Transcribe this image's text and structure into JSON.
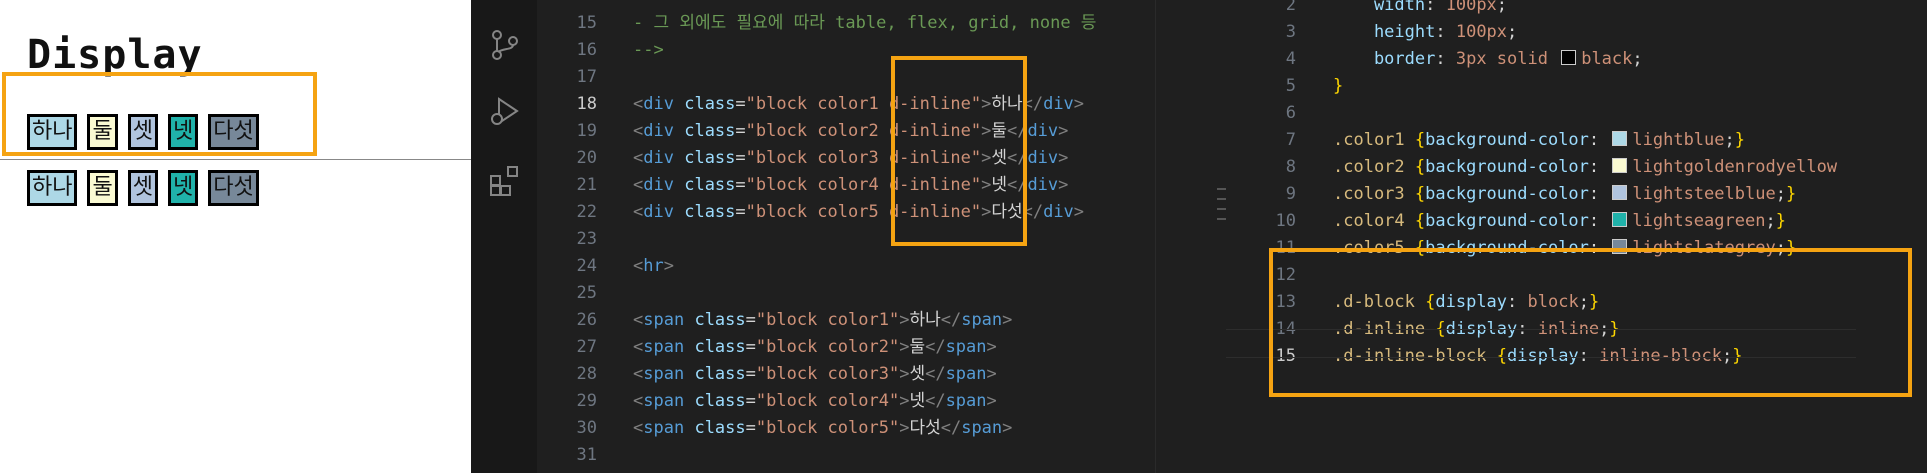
{
  "preview": {
    "heading": "Display",
    "row1": [
      "하나",
      "둘",
      "셋",
      "넷",
      "다섯"
    ],
    "row2": [
      "하나",
      "둘",
      "셋",
      "넷",
      "다섯"
    ]
  },
  "editor_left": {
    "lines": [
      {
        "n": "15",
        "parts": [
          {
            "c": "cmt",
            "t": "- 그 외에도 필요에 따라 table, flex, grid, none 등"
          }
        ]
      },
      {
        "n": "16",
        "parts": [
          {
            "c": "cmt",
            "t": "-->"
          }
        ]
      },
      {
        "n": "17",
        "parts": []
      },
      {
        "n": "18",
        "active": true,
        "parts": [
          {
            "c": "tag",
            "t": "<"
          },
          {
            "c": "tname",
            "t": "div"
          },
          {
            "c": "txt",
            "t": " "
          },
          {
            "c": "attr",
            "t": "class"
          },
          {
            "c": "txt",
            "t": "="
          },
          {
            "c": "str",
            "t": "\"block color1 d-inline\""
          },
          {
            "c": "tag",
            "t": ">"
          },
          {
            "c": "txt",
            "t": "하나"
          },
          {
            "c": "tag",
            "t": "</"
          },
          {
            "c": "tname",
            "t": "div"
          },
          {
            "c": "tag",
            "t": ">"
          }
        ]
      },
      {
        "n": "19",
        "parts": [
          {
            "c": "tag",
            "t": "<"
          },
          {
            "c": "tname",
            "t": "div"
          },
          {
            "c": "txt",
            "t": " "
          },
          {
            "c": "attr",
            "t": "class"
          },
          {
            "c": "txt",
            "t": "="
          },
          {
            "c": "str",
            "t": "\"block color2 d-inline\""
          },
          {
            "c": "tag",
            "t": ">"
          },
          {
            "c": "txt",
            "t": "둘"
          },
          {
            "c": "tag",
            "t": "</"
          },
          {
            "c": "tname",
            "t": "div"
          },
          {
            "c": "tag",
            "t": ">"
          }
        ]
      },
      {
        "n": "20",
        "parts": [
          {
            "c": "tag",
            "t": "<"
          },
          {
            "c": "tname",
            "t": "div"
          },
          {
            "c": "txt",
            "t": " "
          },
          {
            "c": "attr",
            "t": "class"
          },
          {
            "c": "txt",
            "t": "="
          },
          {
            "c": "str",
            "t": "\"block color3 d-inline\""
          },
          {
            "c": "tag",
            "t": ">"
          },
          {
            "c": "txt",
            "t": "셋"
          },
          {
            "c": "tag",
            "t": "</"
          },
          {
            "c": "tname",
            "t": "div"
          },
          {
            "c": "tag",
            "t": ">"
          }
        ]
      },
      {
        "n": "21",
        "parts": [
          {
            "c": "tag",
            "t": "<"
          },
          {
            "c": "tname",
            "t": "div"
          },
          {
            "c": "txt",
            "t": " "
          },
          {
            "c": "attr",
            "t": "class"
          },
          {
            "c": "txt",
            "t": "="
          },
          {
            "c": "str",
            "t": "\"block color4 d-inline\""
          },
          {
            "c": "tag",
            "t": ">"
          },
          {
            "c": "txt",
            "t": "넷"
          },
          {
            "c": "tag",
            "t": "</"
          },
          {
            "c": "tname",
            "t": "div"
          },
          {
            "c": "tag",
            "t": ">"
          }
        ]
      },
      {
        "n": "22",
        "parts": [
          {
            "c": "tag",
            "t": "<"
          },
          {
            "c": "tname",
            "t": "div"
          },
          {
            "c": "txt",
            "t": " "
          },
          {
            "c": "attr",
            "t": "class"
          },
          {
            "c": "txt",
            "t": "="
          },
          {
            "c": "str",
            "t": "\"block color5 d-inline\""
          },
          {
            "c": "tag",
            "t": ">"
          },
          {
            "c": "txt",
            "t": "다섯"
          },
          {
            "c": "tag",
            "t": "</"
          },
          {
            "c": "tname",
            "t": "div"
          },
          {
            "c": "tag",
            "t": ">"
          }
        ]
      },
      {
        "n": "23",
        "parts": []
      },
      {
        "n": "24",
        "parts": [
          {
            "c": "tag",
            "t": "<"
          },
          {
            "c": "tname",
            "t": "hr"
          },
          {
            "c": "tag",
            "t": ">"
          }
        ]
      },
      {
        "n": "25",
        "parts": []
      },
      {
        "n": "26",
        "parts": [
          {
            "c": "tag",
            "t": "<"
          },
          {
            "c": "tname",
            "t": "span"
          },
          {
            "c": "txt",
            "t": " "
          },
          {
            "c": "attr",
            "t": "class"
          },
          {
            "c": "txt",
            "t": "="
          },
          {
            "c": "str",
            "t": "\"block color1\""
          },
          {
            "c": "tag",
            "t": ">"
          },
          {
            "c": "txt",
            "t": "하나"
          },
          {
            "c": "tag",
            "t": "</"
          },
          {
            "c": "tname",
            "t": "span"
          },
          {
            "c": "tag",
            "t": ">"
          }
        ]
      },
      {
        "n": "27",
        "parts": [
          {
            "c": "tag",
            "t": "<"
          },
          {
            "c": "tname",
            "t": "span"
          },
          {
            "c": "txt",
            "t": " "
          },
          {
            "c": "attr",
            "t": "class"
          },
          {
            "c": "txt",
            "t": "="
          },
          {
            "c": "str",
            "t": "\"block color2\""
          },
          {
            "c": "tag",
            "t": ">"
          },
          {
            "c": "txt",
            "t": "둘"
          },
          {
            "c": "tag",
            "t": "</"
          },
          {
            "c": "tname",
            "t": "span"
          },
          {
            "c": "tag",
            "t": ">"
          }
        ]
      },
      {
        "n": "28",
        "parts": [
          {
            "c": "tag",
            "t": "<"
          },
          {
            "c": "tname",
            "t": "span"
          },
          {
            "c": "txt",
            "t": " "
          },
          {
            "c": "attr",
            "t": "class"
          },
          {
            "c": "txt",
            "t": "="
          },
          {
            "c": "str",
            "t": "\"block color3\""
          },
          {
            "c": "tag",
            "t": ">"
          },
          {
            "c": "txt",
            "t": "셋"
          },
          {
            "c": "tag",
            "t": "</"
          },
          {
            "c": "tname",
            "t": "span"
          },
          {
            "c": "tag",
            "t": ">"
          }
        ]
      },
      {
        "n": "29",
        "parts": [
          {
            "c": "tag",
            "t": "<"
          },
          {
            "c": "tname",
            "t": "span"
          },
          {
            "c": "txt",
            "t": " "
          },
          {
            "c": "attr",
            "t": "class"
          },
          {
            "c": "txt",
            "t": "="
          },
          {
            "c": "str",
            "t": "\"block color4\""
          },
          {
            "c": "tag",
            "t": ">"
          },
          {
            "c": "txt",
            "t": "넷"
          },
          {
            "c": "tag",
            "t": "</"
          },
          {
            "c": "tname",
            "t": "span"
          },
          {
            "c": "tag",
            "t": ">"
          }
        ]
      },
      {
        "n": "30",
        "parts": [
          {
            "c": "tag",
            "t": "<"
          },
          {
            "c": "tname",
            "t": "span"
          },
          {
            "c": "txt",
            "t": " "
          },
          {
            "c": "attr",
            "t": "class"
          },
          {
            "c": "txt",
            "t": "="
          },
          {
            "c": "str",
            "t": "\"block color5\""
          },
          {
            "c": "tag",
            "t": ">"
          },
          {
            "c": "txt",
            "t": "다섯"
          },
          {
            "c": "tag",
            "t": "</"
          },
          {
            "c": "tname",
            "t": "span"
          },
          {
            "c": "tag",
            "t": ">"
          }
        ]
      },
      {
        "n": "31",
        "parts": []
      }
    ]
  },
  "editor_right": {
    "lines": [
      {
        "n": "2",
        "parts": [
          {
            "c": "prop",
            "t": "    width"
          },
          {
            "c": "punct",
            "t": ": "
          },
          {
            "c": "val",
            "t": "100px"
          },
          {
            "c": "punct",
            "t": ";"
          }
        ]
      },
      {
        "n": "3",
        "parts": [
          {
            "c": "prop",
            "t": "    height"
          },
          {
            "c": "punct",
            "t": ": "
          },
          {
            "c": "val",
            "t": "100px"
          },
          {
            "c": "punct",
            "t": ";"
          }
        ]
      },
      {
        "n": "4",
        "parts": [
          {
            "c": "prop",
            "t": "    border"
          },
          {
            "c": "punct",
            "t": ": "
          },
          {
            "c": "val",
            "t": "3px solid "
          },
          {
            "c": "swatch",
            "t": "#000000"
          },
          {
            "c": "val",
            "t": "black"
          },
          {
            "c": "punct",
            "t": ";"
          }
        ]
      },
      {
        "n": "5",
        "parts": [
          {
            "c": "brace",
            "t": "}"
          }
        ]
      },
      {
        "n": "6",
        "parts": []
      },
      {
        "n": "7",
        "parts": [
          {
            "c": "sel",
            "t": ".color1 "
          },
          {
            "c": "brace",
            "t": "{"
          },
          {
            "c": "prop",
            "t": "background-color"
          },
          {
            "c": "punct",
            "t": ": "
          },
          {
            "c": "swatch",
            "t": "#add8e6"
          },
          {
            "c": "val",
            "t": "lightblue"
          },
          {
            "c": "punct",
            "t": ";"
          },
          {
            "c": "brace",
            "t": "}"
          }
        ]
      },
      {
        "n": "8",
        "parts": [
          {
            "c": "sel",
            "t": ".color2 "
          },
          {
            "c": "brace",
            "t": "{"
          },
          {
            "c": "prop",
            "t": "background-color"
          },
          {
            "c": "punct",
            "t": ": "
          },
          {
            "c": "swatch",
            "t": "#fafad2"
          },
          {
            "c": "val",
            "t": "lightgoldenrodyellow"
          }
        ]
      },
      {
        "n": "9",
        "parts": [
          {
            "c": "sel",
            "t": ".color3 "
          },
          {
            "c": "brace",
            "t": "{"
          },
          {
            "c": "prop",
            "t": "background-color"
          },
          {
            "c": "punct",
            "t": ": "
          },
          {
            "c": "swatch",
            "t": "#b0c4de"
          },
          {
            "c": "val",
            "t": "lightsteelblue"
          },
          {
            "c": "punct",
            "t": ";"
          },
          {
            "c": "brace",
            "t": "}"
          }
        ]
      },
      {
        "n": "10",
        "parts": [
          {
            "c": "sel",
            "t": ".color4 "
          },
          {
            "c": "brace",
            "t": "{"
          },
          {
            "c": "prop",
            "t": "background-color"
          },
          {
            "c": "punct",
            "t": ": "
          },
          {
            "c": "swatch",
            "t": "#20b2aa"
          },
          {
            "c": "val",
            "t": "lightseagreen"
          },
          {
            "c": "punct",
            "t": ";"
          },
          {
            "c": "brace",
            "t": "}"
          }
        ]
      },
      {
        "n": "11",
        "parts": [
          {
            "c": "sel",
            "t": ".color5 "
          },
          {
            "c": "brace",
            "t": "{"
          },
          {
            "c": "prop",
            "t": "background-color"
          },
          {
            "c": "punct",
            "t": ": "
          },
          {
            "c": "swatch",
            "t": "#778899"
          },
          {
            "c": "val",
            "t": "lightslategrey"
          },
          {
            "c": "punct",
            "t": ";"
          },
          {
            "c": "brace",
            "t": "}"
          }
        ]
      },
      {
        "n": "12",
        "parts": []
      },
      {
        "n": "13",
        "parts": [
          {
            "c": "sel",
            "t": ".d-block "
          },
          {
            "c": "brace",
            "t": "{"
          },
          {
            "c": "prop",
            "t": "display"
          },
          {
            "c": "punct",
            "t": ": "
          },
          {
            "c": "val",
            "t": "block"
          },
          {
            "c": "punct",
            "t": ";"
          },
          {
            "c": "brace",
            "t": "}"
          }
        ]
      },
      {
        "n": "14",
        "parts": [
          {
            "c": "sel",
            "t": ".d-inline "
          },
          {
            "c": "brace",
            "t": "{"
          },
          {
            "c": "prop",
            "t": "display"
          },
          {
            "c": "punct",
            "t": ": "
          },
          {
            "c": "val",
            "t": "inline"
          },
          {
            "c": "punct",
            "t": ";"
          },
          {
            "c": "brace",
            "t": "}"
          }
        ]
      },
      {
        "n": "15",
        "active": true,
        "parts": [
          {
            "c": "sel",
            "t": ".d-inline-block "
          },
          {
            "c": "brace",
            "t": "{"
          },
          {
            "c": "prop",
            "t": "display"
          },
          {
            "c": "punct",
            "t": ": "
          },
          {
            "c": "val",
            "t": "inline-block"
          },
          {
            "c": "punct",
            "t": ";"
          },
          {
            "c": "brace",
            "t": "}"
          }
        ]
      }
    ]
  },
  "colors": {
    "highlight": "#f5a312",
    "color1": "#add8e6",
    "color2": "#fafad2",
    "color3": "#b0c4de",
    "color4": "#20b2aa",
    "color5": "#778899"
  },
  "icons": [
    "source-control-icon",
    "run-debug-icon",
    "extensions-icon"
  ]
}
